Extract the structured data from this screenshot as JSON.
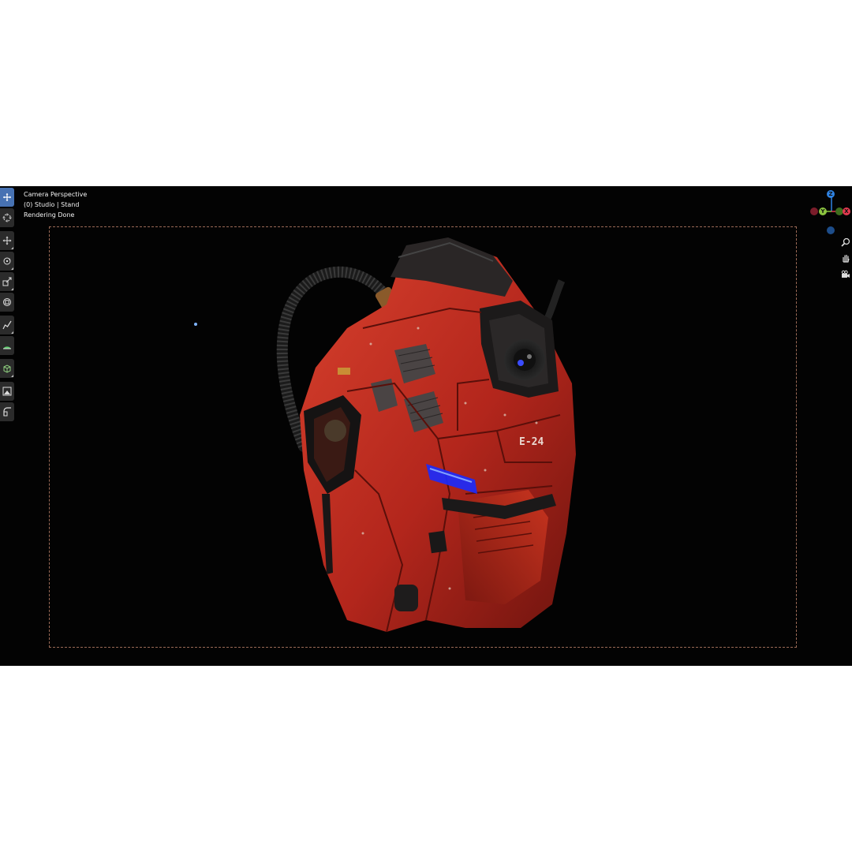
{
  "viewport": {
    "overlay": {
      "view_name": "Camera Perspective",
      "collection": "(0) Studio | Stand",
      "status": "Rendering Done"
    },
    "toolbar": {
      "tools": [
        {
          "name": "tweak",
          "icon": "cursor-select-icon",
          "active": true
        },
        {
          "name": "cursor",
          "icon": "3d-cursor-icon"
        },
        {
          "name": "move",
          "icon": "move-icon"
        },
        {
          "name": "rotate",
          "icon": "rotate-icon"
        },
        {
          "name": "scale",
          "icon": "scale-icon"
        },
        {
          "name": "transform",
          "icon": "transform-icon"
        },
        {
          "name": "annotate",
          "icon": "annotate-icon"
        },
        {
          "name": "measure",
          "icon": "measure-icon"
        },
        {
          "name": "add-cube",
          "icon": "add-cube-icon"
        },
        {
          "name": "render-region",
          "icon": "render-region-icon"
        },
        {
          "name": "shear",
          "icon": "shear-icon"
        }
      ]
    },
    "gizmo": {
      "axes": {
        "x": "X",
        "y": "Y",
        "z": "Z"
      },
      "colors": {
        "x": "#e2394f",
        "y": "#8bc43f",
        "z": "#2f83e3"
      }
    },
    "nav_buttons": [
      "zoom-icon",
      "pan-hand-icon",
      "camera-view-icon"
    ],
    "model": {
      "decal_text": "E-24",
      "colors": {
        "armor": "#b3261c",
        "armor_light": "#d9422e",
        "dark_panel": "#262222",
        "glow": "#2f5cff"
      }
    },
    "colors": {
      "background": "#030303",
      "camera_frame": "#9a6a56",
      "active_tool": "#4772b3"
    }
  }
}
